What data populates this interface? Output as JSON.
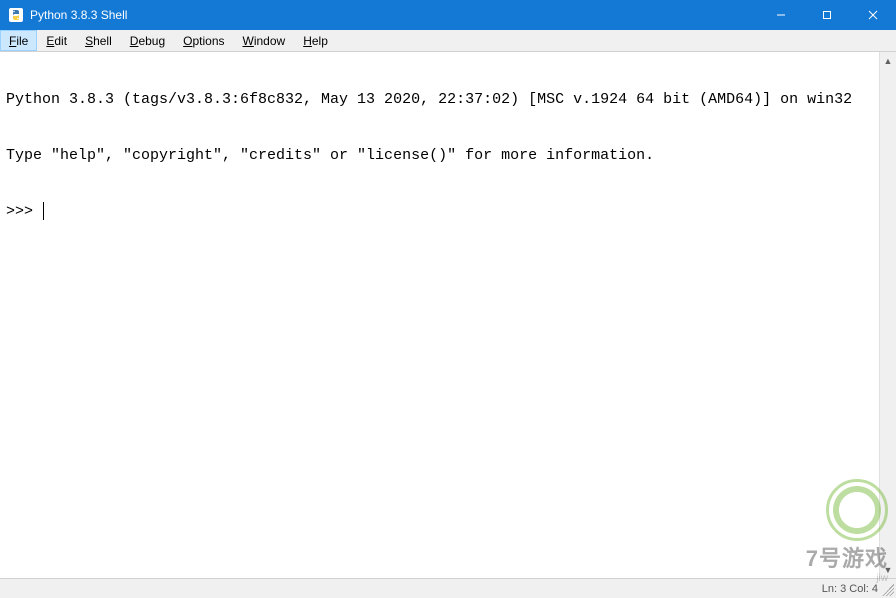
{
  "titlebar": {
    "title": "Python 3.8.3 Shell"
  },
  "menubar": {
    "items": [
      {
        "label": "File",
        "accel": "F",
        "selected": true
      },
      {
        "label": "Edit",
        "accel": "E",
        "selected": false
      },
      {
        "label": "Shell",
        "accel": "S",
        "selected": false
      },
      {
        "label": "Debug",
        "accel": "D",
        "selected": false
      },
      {
        "label": "Options",
        "accel": "O",
        "selected": false
      },
      {
        "label": "Window",
        "accel": "W",
        "selected": false
      },
      {
        "label": "Help",
        "accel": "H",
        "selected": false
      }
    ]
  },
  "shell": {
    "line1": "Python 3.8.3 (tags/v3.8.3:6f8c832, May 13 2020, 22:37:02) [MSC v.1924 64 bit (AMD64)] on win32",
    "line2": "Type \"help\", \"copyright\", \"credits\" or \"license()\" for more information.",
    "prompt": ">>> "
  },
  "statusbar": {
    "position": "Ln: 3  Col: 4"
  },
  "watermark": {
    "text1": "7号游戏",
    "text2": "jiw"
  }
}
